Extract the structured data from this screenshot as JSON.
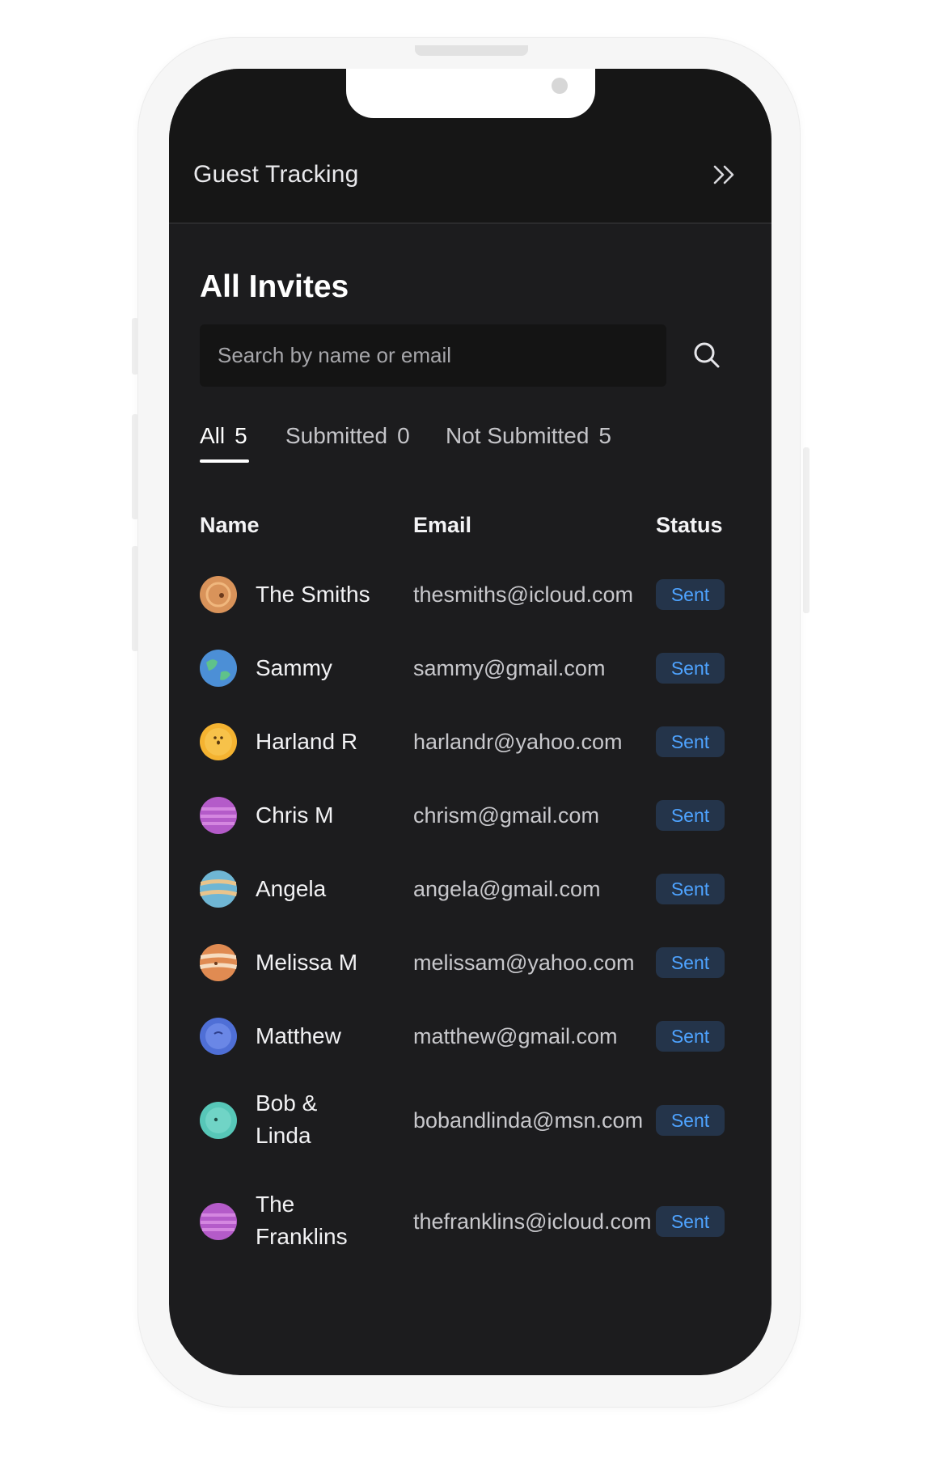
{
  "header": {
    "title": "Guest Tracking",
    "expand_icon": "double-chevron-right-icon"
  },
  "main": {
    "title": "All Invites",
    "search": {
      "placeholder": "Search by name or email",
      "value": "",
      "icon": "search-icon"
    },
    "tabs": [
      {
        "label": "All",
        "count": "5",
        "active": true
      },
      {
        "label": "Submitted",
        "count": "0",
        "active": false
      },
      {
        "label": "Not Submitted",
        "count": "5",
        "active": false
      }
    ],
    "columns": {
      "name": "Name",
      "email": "Email",
      "status": "Status"
    },
    "guests": [
      {
        "name": "The Smiths",
        "email": "thesmiths@icloud.com",
        "status": "Sent",
        "avatar": "orange-planet-icon"
      },
      {
        "name": "Sammy",
        "email": "sammy@gmail.com",
        "status": "Sent",
        "avatar": "earth-planet-icon"
      },
      {
        "name": "Harland R",
        "email": "harlandr@yahoo.com",
        "status": "Sent",
        "avatar": "yellow-sun-icon"
      },
      {
        "name": "Chris M",
        "email": "chrism@gmail.com",
        "status": "Sent",
        "avatar": "purple-planet-icon"
      },
      {
        "name": "Angela",
        "email": "angela@gmail.com",
        "status": "Sent",
        "avatar": "striped-blue-planet-icon"
      },
      {
        "name": "Melissa M",
        "email": "melissam@yahoo.com",
        "status": "Sent",
        "avatar": "jupiter-planet-icon"
      },
      {
        "name": "Matthew",
        "email": "matthew@gmail.com",
        "status": "Sent",
        "avatar": "blue-planet-icon"
      },
      {
        "name": "Bob & Linda",
        "email": "bobandlinda@msn.com",
        "status": "Sent",
        "avatar": "teal-planet-icon"
      },
      {
        "name": "The Franklins",
        "email": "thefranklins@icloud.com",
        "status": "Sent",
        "avatar": "purple-planet-icon"
      }
    ]
  },
  "colors": {
    "screen_bg": "#1c1c1e",
    "header_bg": "#161616",
    "badge_bg": "#24344a",
    "badge_text": "#4ea3ff"
  }
}
